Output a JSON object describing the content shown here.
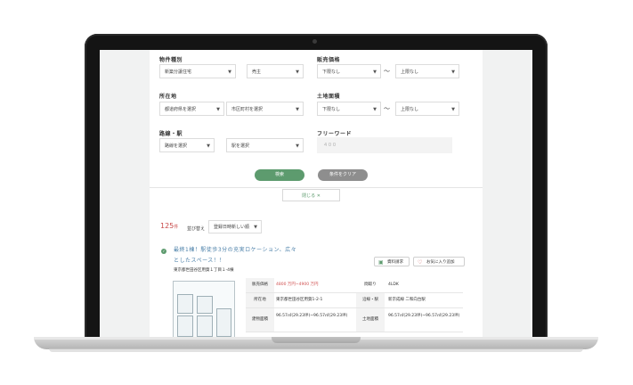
{
  "search": {
    "property_type": {
      "label": "物件種別",
      "value1": "新築分譲住宅",
      "value2": "売主"
    },
    "price": {
      "label": "販売価格",
      "min": "下限なし",
      "max": "上限なし",
      "tilde": "〜"
    },
    "location": {
      "label": "所在地",
      "pref": "都道府県を選択",
      "city": "市区町村を選択"
    },
    "land_area": {
      "label": "土地面積",
      "min": "下限なし",
      "max": "上限なし",
      "tilde": "〜"
    },
    "line": {
      "label": "路線・駅",
      "line": "路線を選択",
      "station": "駅を選択"
    },
    "freeword": {
      "label": "フリーワード",
      "value": "４００"
    },
    "search_btn": "検索",
    "clear_btn": "条件をクリア",
    "close_btn": "閉じる ✕"
  },
  "results": {
    "count": "125",
    "count_unit": "件",
    "sort_label": "並び替え",
    "sort_value": "登録日時新しい順"
  },
  "listing": {
    "title_line1": "最終1棟！駅徒歩3分の充実ロケーション、広々",
    "title_line2": "としたスペース！！",
    "address": "東京都世田谷区用賀１丁目１-4棟",
    "request_btn": "資料請求",
    "favorite_btn": "お気に入り追加",
    "rows": [
      {
        "k1": "販売価格",
        "v1": "4800 万円~4900 万円",
        "k2": "間取り",
        "v2": "4LDK"
      },
      {
        "k1": "所在地",
        "v1": "東京都世田谷区用賀1-2-1",
        "k2": "沿線・駅",
        "v2": "新京成線 二和向台駅"
      },
      {
        "k1": "建物面積",
        "v1": "96.57㎡(29.23坪)~96.57㎡(29.23坪)",
        "k2": "土地面積",
        "v2": "96.57㎡(29.23坪)~96.57㎡(29.23坪)"
      }
    ]
  }
}
